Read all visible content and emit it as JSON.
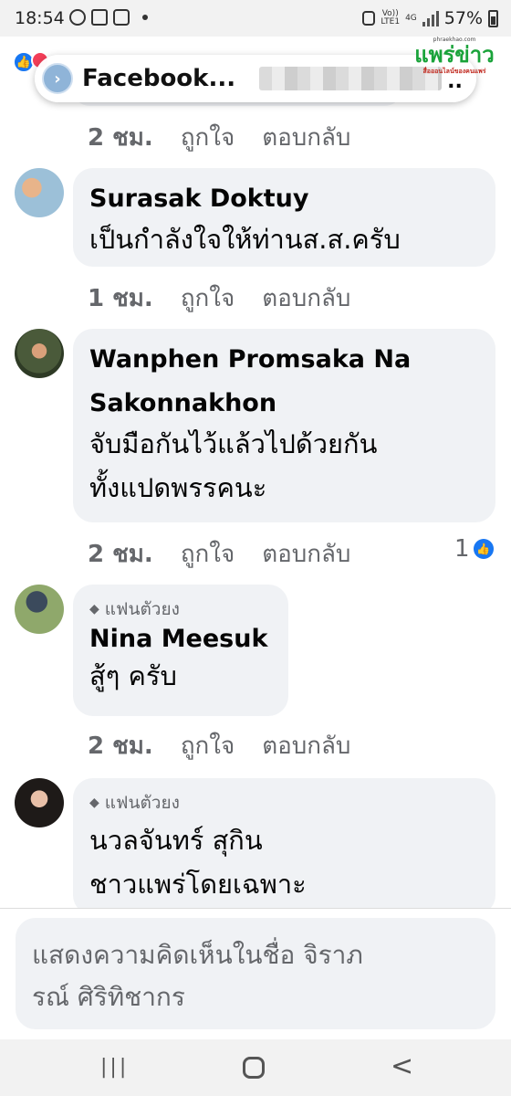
{
  "status_bar": {
    "time": "18:54",
    "network_top": "Vo))",
    "network_bottom": "LTE1",
    "network_type": "4G",
    "battery": "57%"
  },
  "watermark": {
    "url": "phraekhao.com",
    "title": "แพร่ข่าว",
    "subtitle": "สื่อออนไลน์ของคนแพร่"
  },
  "bubble": {
    "title": "Facebook...",
    "trailing": ".."
  },
  "comments": [
    {
      "time": "2 ชม.",
      "like_label": "ถูกใจ",
      "reply_label": "ตอบกลับ"
    },
    {
      "name": "Surasak Doktuy",
      "text": "เป็นกำลังใจให้ท่านส.ส.ครับ",
      "time": "1 ชม.",
      "like_label": "ถูกใจ",
      "reply_label": "ตอบกลับ"
    },
    {
      "name_line1": "Wanphen Promsaka Na",
      "name_line2": "Sakonnakhon",
      "text_line1": "จับมือกันไว้แล้วไปด้วยกัน",
      "text_line2": "ทั้งแปดพรรคนะ",
      "time": "2 ชม.",
      "like_label": "ถูกใจ",
      "reply_label": "ตอบกลับ",
      "reactions": "1"
    },
    {
      "badge": "แฟนตัวยง",
      "name": "Nina Meesuk",
      "text": "สู้ๆ ครับ",
      "time": "2 ชม.",
      "like_label": "ถูกใจ",
      "reply_label": "ตอบกลับ"
    },
    {
      "badge": "แฟนตัวยง",
      "name": "นวลจันทร์ สุกิน",
      "text": "ชาวแพร่โดยเฉพาะ"
    }
  ],
  "input": {
    "placeholder_line1": "แสดงความคิดเห็นในชื่อ จิราภ",
    "placeholder_line2": "รณ์ ศิริทิชากร"
  },
  "nav": {
    "recent": "|||",
    "back": "<"
  }
}
